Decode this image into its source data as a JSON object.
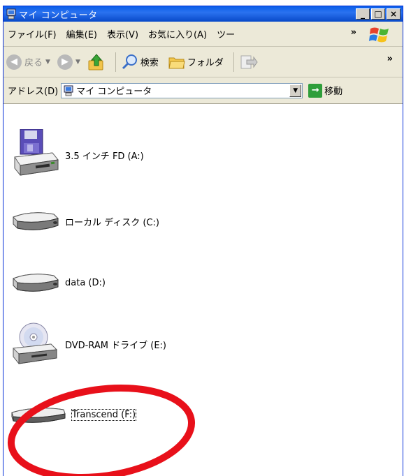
{
  "window": {
    "title": "マイ コンピュータ"
  },
  "window_buttons": {
    "minimize": "_",
    "maximize": "□",
    "close": "×"
  },
  "menubar": {
    "items": [
      "ファイル(F)",
      "編集(E)",
      "表示(V)",
      "お気に入り(A)",
      "ツー"
    ],
    "overflow": "»"
  },
  "toolbar": {
    "back_label": "戻る",
    "search_label": "検索",
    "folders_label": "フォルダ",
    "overflow": "»"
  },
  "addressbar": {
    "label": "アドレス(D)",
    "value": "マイ コンピュータ",
    "go_label": "移動"
  },
  "drives": [
    {
      "label": "3.5 インチ FD (A:)",
      "icon": "floppy-drive-icon"
    },
    {
      "label": "ローカル ディスク (C:)",
      "icon": "hard-disk-icon"
    },
    {
      "label": "data (D:)",
      "icon": "hard-disk-icon"
    },
    {
      "label": "DVD-RAM ドライブ (E:)",
      "icon": "dvd-drive-icon"
    },
    {
      "label": "Transcend (F:)",
      "icon": "removable-disk-icon"
    }
  ],
  "annotation": {
    "color": "#e8101a"
  }
}
